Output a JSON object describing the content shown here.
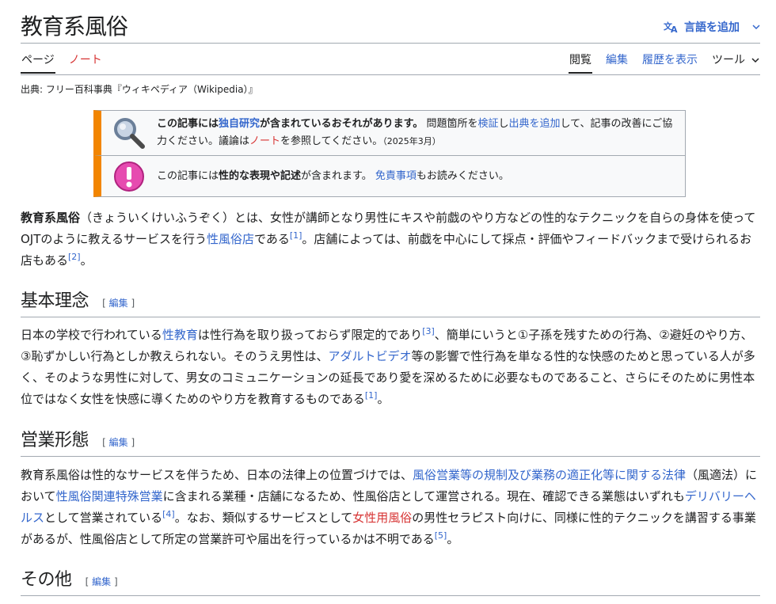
{
  "title": "教育系風俗",
  "lang_button": "言語を追加",
  "tabs_left": [
    "ページ",
    "ノート"
  ],
  "tabs_right": [
    "閲覧",
    "編集",
    "履歴を表示",
    "ツール"
  ],
  "tagline": "出典: フリー百科事典『ウィキペディア（Wikipedia）』",
  "ambox1": {
    "b1": "この記事には",
    "l1": "独自研究",
    "b2": "が含まれているおそれがあります。",
    "t1": "問題箇所を",
    "l2": "検証",
    "t2": "し",
    "l3": "出典を追加",
    "t3": "して、記事の改善にご協力ください。議論は",
    "l4": "ノート",
    "t4": "を参照してください。",
    "date": "（2025年3月）"
  },
  "ambox2": {
    "t1": "この記事には",
    "b1": "性的な表現や記述",
    "t2": "が含まれます。",
    "l1": "免責事項",
    "t3": "もお読みください。"
  },
  "intro": {
    "b1": "教育系風俗",
    "t1": "（きょういくけいふうぞく）とは、女性が講師となり男性にキスや前戯のやり方などの性的なテクニックを自らの身体を使ってOJTのように教えるサービスを行う",
    "l1": "性風俗店",
    "t2": "である",
    "r1": "[1]",
    "t3": "。店舗によっては、前戯を中心にして採点・評価やフィードバックまで受けられるお店もある",
    "r2": "[2]",
    "t4": "。"
  },
  "edit_label": "編集",
  "section1": {
    "heading": "基本理念",
    "t1": "日本の学校で行われている",
    "l1": "性教育",
    "t2": "は性行為を取り扱っておらず限定的であり",
    "r1": "[3]",
    "t3": "、簡単にいうと①子孫を残すための行為、②避妊のやり方、③恥ずかしい行為としか教えられない。そのうえ男性は、",
    "l2": "アダルトビデオ",
    "t4": "等の影響で性行為を単なる性的な快感のためと思っている人が多く、そのような男性に対して、男女のコミュニケーションの延長であり愛を深めるために必要なものであること、さらにそのために男性本位ではなく女性を快感に導くためのやり方を教育するものである",
    "r2": "[1]",
    "t5": "。"
  },
  "section2": {
    "heading": "営業形態",
    "t1": "教育系風俗は性的なサービスを伴うため、日本の法律上の位置づけでは、",
    "l1": "風俗営業等の規制及び業務の適正化等に関する法律",
    "t2": "（風適法）において",
    "l2": "性風俗関連特殊営業",
    "t3": "に含まれる業種・店舗になるため、性風俗店として運営される。現在、確認できる業態はいずれも",
    "l3": "デリバリーヘルス",
    "t4": "として営業されている",
    "r1": "[4]",
    "t5": "。なお、類似するサービスとして",
    "l4": "女性用風俗",
    "t6": "の男性セラピスト向けに、同様に性的テクニックを講習する事業があるが、性風俗店として所定の営業許可や届出を行っているかは不明である",
    "r2": "[5]",
    "t7": "。"
  },
  "section3": {
    "heading": "その他"
  }
}
